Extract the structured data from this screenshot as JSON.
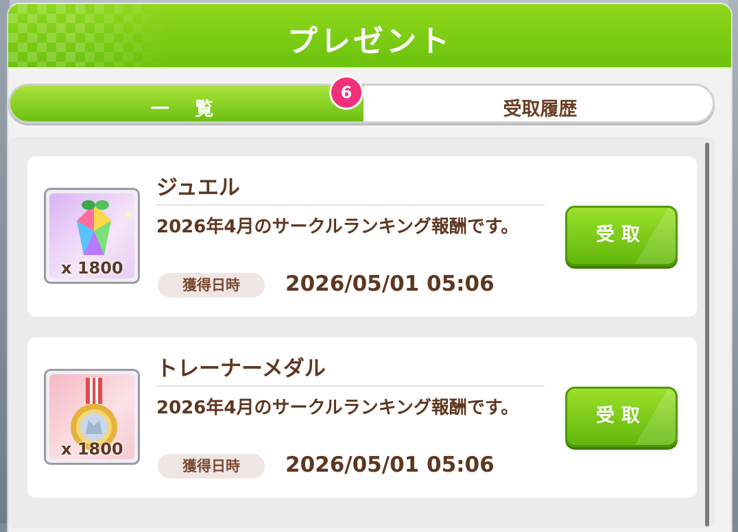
{
  "header": {
    "title": "プレゼント"
  },
  "tabs": [
    {
      "label": "一 覧",
      "active": true,
      "badge": "6"
    },
    {
      "label": "受取履歴",
      "active": false
    }
  ],
  "presents": [
    {
      "name": "ジュエル",
      "icon": "jewel-icon",
      "quantity": "x 1800",
      "description": "2026年4月のサークルランキング報酬です。",
      "date_label": "獲得日時",
      "date": "2026/05/01 05:06",
      "button": "受取"
    },
    {
      "name": "トレーナーメダル",
      "icon": "medal-icon",
      "quantity": "x 1800",
      "description": "2026年4月のサークルランキング報酬です。",
      "date_label": "獲得日時",
      "date": "2026/05/01 05:06",
      "button": "受取"
    }
  ],
  "colors": {
    "header_green": "#7ccc14",
    "accent_brown": "#5e3720",
    "badge_pink": "#f0307a"
  }
}
